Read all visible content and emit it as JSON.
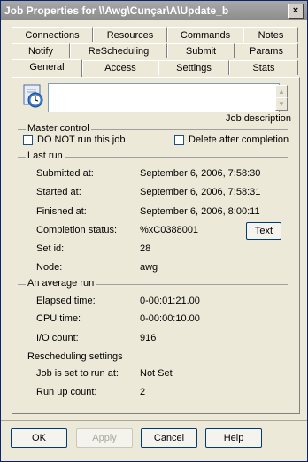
{
  "window": {
    "title": "Job Properties for \\\\Awg\\Cunçar\\A\\Update_b",
    "close_glyph": "×"
  },
  "tabs": {
    "row1": [
      "Connections",
      "Resources",
      "Commands",
      "Notes"
    ],
    "row2": [
      "Notify",
      "ReScheduling",
      "Submit",
      "Params"
    ],
    "row3": [
      "General",
      "Access",
      "Settings",
      "Stats"
    ],
    "active": "General"
  },
  "description": {
    "value": "",
    "label": "Job description",
    "icon": "job-icon"
  },
  "master_control": {
    "label": "Master control",
    "do_not_run": {
      "label": "DO NOT run this job",
      "checked": false
    },
    "delete_after": {
      "label": "Delete after completion",
      "checked": false
    }
  },
  "last_run": {
    "label": "Last run",
    "rows": [
      {
        "label": "Submitted at:",
        "value": "September 6, 2006,  7:58:30"
      },
      {
        "label": "Started at:",
        "value": "September 6, 2006,  7:58:31"
      },
      {
        "label": "Finished at:",
        "value": "September 6, 2006,  8:00:11"
      },
      {
        "label": "Completion status:",
        "value": "%xC0388001"
      },
      {
        "label": "Set id:",
        "value": "28"
      },
      {
        "label": "Node:",
        "value": "awg"
      }
    ],
    "text_button": "Text"
  },
  "average_run": {
    "label": "An average run",
    "rows": [
      {
        "label": "Elapsed time:",
        "value": "0-00:01:21.00"
      },
      {
        "label": "CPU time:",
        "value": "0-00:00:10.00"
      },
      {
        "label": "I/O count:",
        "value": "916"
      }
    ]
  },
  "rescheduling": {
    "label": "Rescheduling settings",
    "rows": [
      {
        "label": "Job is set to run at:",
        "value": "Not Set"
      },
      {
        "label": "Run up count:",
        "value": "2"
      }
    ]
  },
  "buttons": {
    "ok": "OK",
    "apply": "Apply",
    "cancel": "Cancel",
    "help": "Help"
  }
}
